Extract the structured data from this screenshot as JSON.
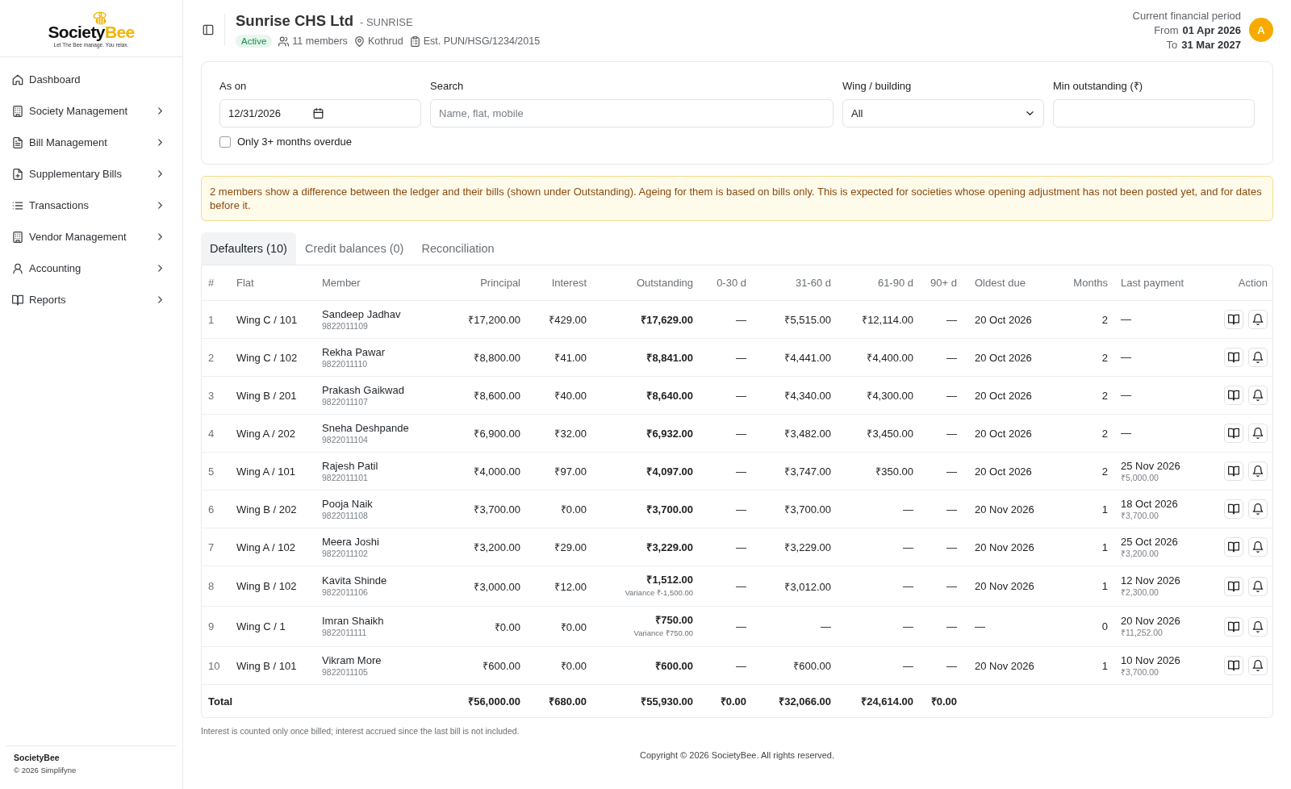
{
  "sidebar": {
    "logo": {
      "wordmark_part_1": "Society",
      "wordmark_part_2": "Bee",
      "tagline": "Let The Bee manage. You relax."
    },
    "items": [
      {
        "label": "Dashboard",
        "has_submenu": false
      },
      {
        "label": "Society Management",
        "has_submenu": true
      },
      {
        "label": "Bill Management",
        "has_submenu": true
      },
      {
        "label": "Supplementary Bills",
        "has_submenu": true
      },
      {
        "label": "Transactions",
        "has_submenu": true
      },
      {
        "label": "Vendor Management",
        "has_submenu": true
      },
      {
        "label": "Accounting",
        "has_submenu": true
      },
      {
        "label": "Reports",
        "has_submenu": true
      }
    ],
    "footer": {
      "brand": "SocietyBee",
      "copyright": "© 2026 Simplifyne"
    }
  },
  "header": {
    "title": "Sunrise CHS Ltd",
    "code": "- SUNRISE",
    "status": "Active",
    "members": "11 members",
    "location": "Kothrud",
    "registration": "Est. PUN/HSG/1234/2015",
    "period": {
      "label": "Current financial period",
      "from_label": "From",
      "from": "01 Apr 2026",
      "to_label": "To",
      "to": "31 Mar 2027"
    },
    "avatar": "A"
  },
  "filters": {
    "as_on": {
      "label": "As on",
      "value": "12/31/2026"
    },
    "search": {
      "label": "Search",
      "placeholder": "Name, flat, mobile"
    },
    "wing": {
      "label": "Wing / building",
      "value": "All"
    },
    "min_outstanding": {
      "label": "Min outstanding (₹)"
    },
    "overdue_only": {
      "label": "Only 3+ months overdue",
      "checked": false
    }
  },
  "alert": "2 members show a difference between the ledger and their bills (shown under Outstanding). Ageing for them is based on bills only. This is expected for societies whose opening adjustment has not been posted yet, and for dates before it.",
  "tabs": [
    {
      "label": "Defaulters (10)",
      "selected": true
    },
    {
      "label": "Credit balances (0)",
      "selected": false
    },
    {
      "label": "Reconciliation",
      "selected": false
    }
  ],
  "table": {
    "columns": [
      "#",
      "Flat",
      "Member",
      "Principal",
      "Interest",
      "Outstanding",
      "0-30 d",
      "31-60 d",
      "61-90 d",
      "90+ d",
      "Oldest due",
      "Months",
      "Last payment",
      "Action"
    ],
    "rows": [
      {
        "number": "1",
        "flat": "Wing C / 101",
        "member": "Sandeep Jadhav",
        "mobile": "9822011109",
        "principal": "₹17,200.00",
        "interest": "₹429.00",
        "outstanding": "₹17,629.00",
        "aging": [
          "—",
          "₹5,515.00",
          "₹12,114.00",
          "—"
        ],
        "oldest_due": "20 Oct 2026",
        "months": "2",
        "last_payment": {
          "date": "—"
        }
      },
      {
        "number": "2",
        "flat": "Wing C / 102",
        "member": "Rekha Pawar",
        "mobile": "9822011110",
        "principal": "₹8,800.00",
        "interest": "₹41.00",
        "outstanding": "₹8,841.00",
        "aging": [
          "—",
          "₹4,441.00",
          "₹4,400.00",
          "—"
        ],
        "oldest_due": "20 Oct 2026",
        "months": "2",
        "last_payment": {
          "date": "—"
        }
      },
      {
        "number": "3",
        "flat": "Wing B / 201",
        "member": "Prakash Gaikwad",
        "mobile": "9822011107",
        "principal": "₹8,600.00",
        "interest": "₹40.00",
        "outstanding": "₹8,640.00",
        "aging": [
          "—",
          "₹4,340.00",
          "₹4,300.00",
          "—"
        ],
        "oldest_due": "20 Oct 2026",
        "months": "2",
        "last_payment": {
          "date": "—"
        }
      },
      {
        "number": "4",
        "flat": "Wing A / 202",
        "member": "Sneha Deshpande",
        "mobile": "9822011104",
        "principal": "₹6,900.00",
        "interest": "₹32.00",
        "outstanding": "₹6,932.00",
        "aging": [
          "—",
          "₹3,482.00",
          "₹3,450.00",
          "—"
        ],
        "oldest_due": "20 Oct 2026",
        "months": "2",
        "last_payment": {
          "date": "—"
        }
      },
      {
        "number": "5",
        "flat": "Wing A / 101",
        "member": "Rajesh Patil",
        "mobile": "9822011101",
        "principal": "₹4,000.00",
        "interest": "₹97.00",
        "outstanding": "₹4,097.00",
        "aging": [
          "—",
          "₹3,747.00",
          "₹350.00",
          "—"
        ],
        "oldest_due": "20 Oct 2026",
        "months": "2",
        "last_payment": {
          "date": "25 Nov 2026",
          "amount": "₹5,000.00"
        }
      },
      {
        "number": "6",
        "flat": "Wing B / 202",
        "member": "Pooja Naik",
        "mobile": "9822011108",
        "principal": "₹3,700.00",
        "interest": "₹0.00",
        "outstanding": "₹3,700.00",
        "aging": [
          "—",
          "₹3,700.00",
          "—",
          "—"
        ],
        "oldest_due": "20 Nov 2026",
        "months": "1",
        "last_payment": {
          "date": "18 Oct 2026",
          "amount": "₹3,700.00"
        }
      },
      {
        "number": "7",
        "flat": "Wing A / 102",
        "member": "Meera Joshi",
        "mobile": "9822011102",
        "principal": "₹3,200.00",
        "interest": "₹29.00",
        "outstanding": "₹3,229.00",
        "aging": [
          "—",
          "₹3,229.00",
          "—",
          "—"
        ],
        "oldest_due": "20 Nov 2026",
        "months": "1",
        "last_payment": {
          "date": "25 Oct 2026",
          "amount": "₹3,200.00"
        }
      },
      {
        "number": "8",
        "flat": "Wing B / 102",
        "member": "Kavita Shinde",
        "mobile": "9822011106",
        "principal": "₹3,000.00",
        "interest": "₹12.00",
        "outstanding": "₹1,512.00",
        "variance": "Variance ₹-1,500.00",
        "aging": [
          "—",
          "₹3,012.00",
          "—",
          "—"
        ],
        "oldest_due": "20 Nov 2026",
        "months": "1",
        "last_payment": {
          "date": "12 Nov 2026",
          "amount": "₹2,300.00"
        }
      },
      {
        "number": "9",
        "flat": "Wing C / 1",
        "member": "Imran Shaikh",
        "mobile": "9822011111",
        "principal": "₹0.00",
        "interest": "₹0.00",
        "outstanding": "₹750.00",
        "variance": "Variance ₹750.00",
        "aging": [
          "—",
          "—",
          "—",
          "—"
        ],
        "oldest_due": "—",
        "months": "0",
        "last_payment": {
          "date": "20 Nov 2026",
          "amount": "₹11,252.00"
        }
      },
      {
        "number": "10",
        "flat": "Wing B / 101",
        "member": "Vikram More",
        "mobile": "9822011105",
        "principal": "₹600.00",
        "interest": "₹0.00",
        "outstanding": "₹600.00",
        "aging": [
          "—",
          "₹600.00",
          "—",
          "—"
        ],
        "oldest_due": "20 Nov 2026",
        "months": "1",
        "last_payment": {
          "date": "10 Nov 2026",
          "amount": "₹3,700.00"
        }
      }
    ],
    "total": {
      "label": "Total",
      "principal": "₹56,000.00",
      "interest": "₹680.00",
      "outstanding": "₹55,930.00",
      "aging": [
        "₹0.00",
        "₹32,066.00",
        "₹24,614.00",
        "₹0.00"
      ]
    }
  },
  "footnote": "Interest is counted only once billed; interest accrued since the last bill is not included.",
  "copyright": "Copyright © 2026 SocietyBee. All rights reserved."
}
